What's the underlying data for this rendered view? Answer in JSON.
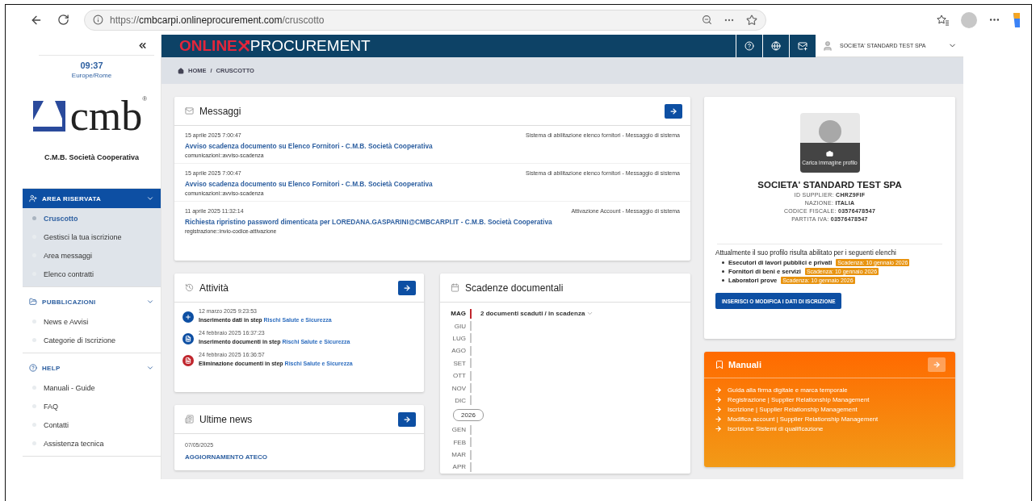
{
  "browser": {
    "url": "https://**cmbcarpi.onlineprocurement.com**/cruscotto"
  },
  "sidebar": {
    "time": "09:37",
    "timezone": "Europe/Rome",
    "logo_text": "cmb",
    "logo_mark": "®",
    "company": "C.M.B. Società Cooperativa",
    "sections": [
      {
        "title": "AREA RISERVATA",
        "kind": "user",
        "active": true,
        "items": [
          {
            "label": "Cruscotto",
            "selected": true
          },
          {
            "label": "Gestisci la tua iscrizione",
            "selected": false
          },
          {
            "label": "Area messaggi",
            "selected": false
          },
          {
            "label": "Elenco contratti",
            "selected": false
          }
        ]
      },
      {
        "title": "PUBBLICAZIONI",
        "kind": "folder",
        "active": false,
        "items": [
          {
            "label": "News e Avvisi",
            "selected": false
          },
          {
            "label": "Categorie di Iscrizione",
            "selected": false
          }
        ]
      },
      {
        "title": "HELP",
        "kind": "help",
        "active": false,
        "items": [
          {
            "label": "Manuali - Guide",
            "selected": false
          },
          {
            "label": "FAQ",
            "selected": false
          },
          {
            "label": "Contatti",
            "selected": false
          },
          {
            "label": "Assistenza tecnica",
            "selected": false
          }
        ]
      }
    ]
  },
  "header": {
    "brand_left": "ONLINE",
    "brand_right": "PROCUREMENT",
    "user": "SOCIETA' STANDARD TEST SPA"
  },
  "breadcrumb": {
    "items": [
      "HOME",
      "CRUSCOTTO"
    ],
    "separator": "/"
  },
  "messages": {
    "title": "Messaggi",
    "items": [
      {
        "date": "15 aprile 2025 7:00:47",
        "source": "Sistema di abilitazione elenco fornitori - Messaggio di sistema",
        "subject": "Avviso scadenza documento su Elenco Fornitori - C.M.B. Società Cooperativa",
        "code": "comunicazioni::avviso-scadenza"
      },
      {
        "date": "15 aprile 2025 7:00:47",
        "source": "Sistema di abilitazione elenco fornitori - Messaggio di sistema",
        "subject": "Avviso scadenza documento su Elenco Fornitori - C.M.B. Società Cooperativa",
        "code": "comunicazioni::avviso-scadenza"
      },
      {
        "date": "11 aprile 2025 11:32:14",
        "source": "Attivazione Account - Messaggio di sistema",
        "subject": "Richiesta ripristino password dimenticata per LOREDANA.GASPARINI@CMBCARPI.IT - C.M.B. Società Cooperativa",
        "code": "registrazione::invio-codice-attivazione"
      }
    ]
  },
  "activities": {
    "title": "Attività",
    "items": [
      {
        "kind": "add",
        "date": "12 marzo 2025 9:23:53",
        "text": "Inserimento dati in step",
        "link": "Rischi Salute e Sicurezza"
      },
      {
        "kind": "document",
        "date": "24 febbraio 2025 16:37:23",
        "text": "Inserimento documenti in step",
        "link": "Rischi Salute e Sicurezza"
      },
      {
        "kind": "delete",
        "date": "24 febbraio 2025 16:36:57",
        "text": "Eliminazione documenti in step",
        "link": "Rischi Salute e Sicurezza"
      }
    ]
  },
  "news": {
    "title": "Ultime news",
    "items": [
      {
        "date": "07/05/2025",
        "title": "AGGIORNAMENTO ATECO"
      }
    ]
  },
  "deadlines": {
    "title": "Scadenze documentali",
    "summary": "2 documenti scaduti / in scadenza",
    "months": [
      {
        "kind": "month",
        "label": "MAG",
        "highlighted": true
      },
      {
        "kind": "month",
        "label": "GIU",
        "highlighted": false
      },
      {
        "kind": "month",
        "label": "LUG",
        "highlighted": false
      },
      {
        "kind": "month",
        "label": "AGO",
        "highlighted": false
      },
      {
        "kind": "month",
        "label": "SET",
        "highlighted": false
      },
      {
        "kind": "month",
        "label": "OTT",
        "highlighted": false
      },
      {
        "kind": "month",
        "label": "NOV",
        "highlighted": false
      },
      {
        "kind": "month",
        "label": "DIC",
        "highlighted": false
      },
      {
        "kind": "year",
        "label": "2026"
      },
      {
        "kind": "month",
        "label": "GEN",
        "highlighted": false
      },
      {
        "kind": "month",
        "label": "FEB",
        "highlighted": false
      },
      {
        "kind": "month",
        "label": "MAR",
        "highlighted": false
      },
      {
        "kind": "month",
        "label": "APR",
        "highlighted": false
      }
    ]
  },
  "profile": {
    "upload": "Carica immagine profilo",
    "name": "SOCIETA' STANDARD TEST SPA",
    "details": [
      "ID SUPPLIER: **CHRZ9FIF**",
      "NAZIONE: **ITALIA**",
      "CODICE FISCALE: **03576478547**",
      "PARTITA IVA: **03576478547**"
    ],
    "intro": "Attualmente il suo profilo risulta abilitato per i seguenti elenchi",
    "lists": [
      {
        "name": "Esecutori di lavori pubblici e privati",
        "badge": "Scadenza: 10 gennaio 2026"
      },
      {
        "name": "Fornitori di beni e servizi",
        "badge": "Scadenza: 10 gennaio 2026"
      },
      {
        "name": "Laboratori prove",
        "badge": "Scadenza: 10 gennaio 2026"
      }
    ],
    "button": "INSERISCI O MODIFICA I DATI DI ISCRIZIONE"
  },
  "manuals": {
    "title": "Manuali",
    "links": [
      "Guida alla firma digitale e marca temporale",
      "Registrazione | Supplier Relationship Management",
      "Iscrizione | Supplier Relationship Management",
      "Modifica account | Supplier Relationship Management",
      "Iscrizione Sistemi di qualificazione"
    ]
  }
}
